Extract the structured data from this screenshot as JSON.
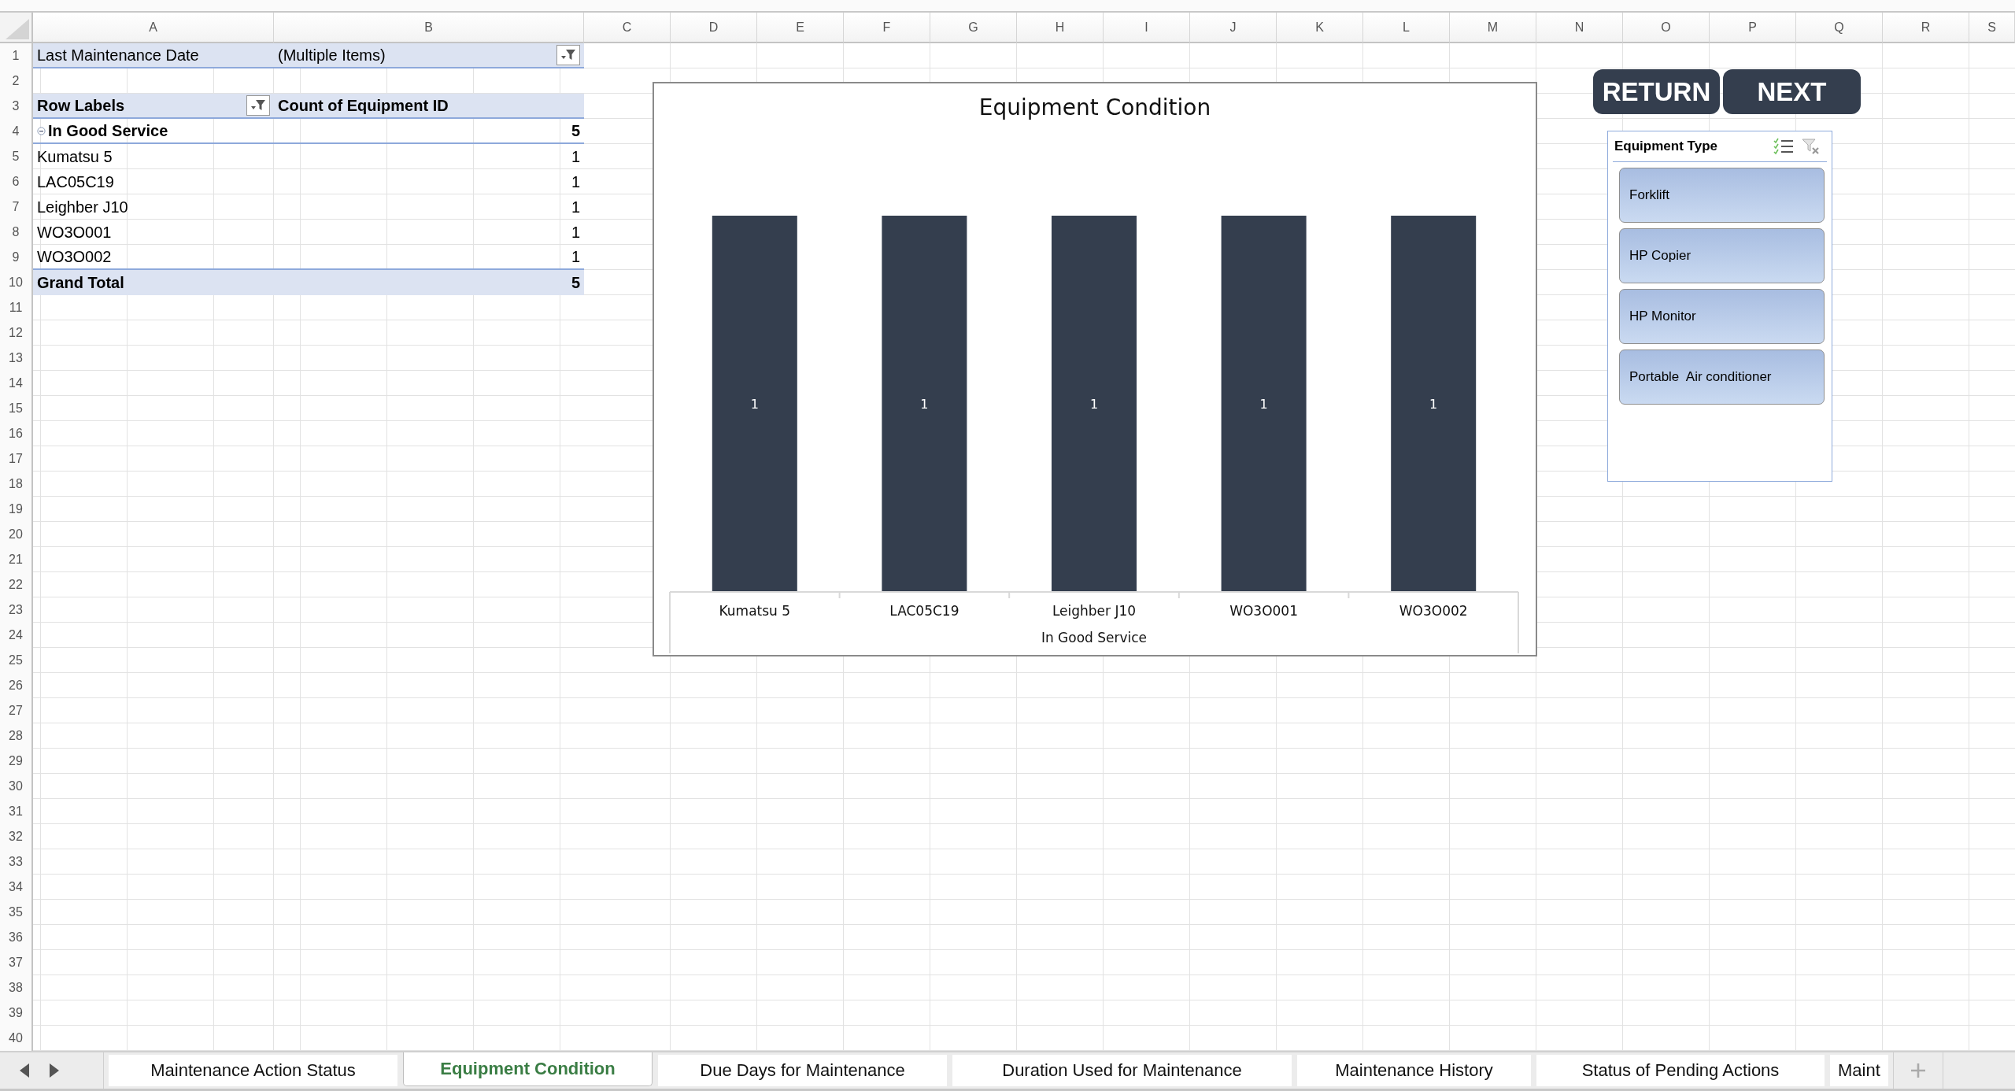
{
  "columns": [
    "A",
    "B",
    "C",
    "D",
    "E",
    "F",
    "G",
    "H",
    "I",
    "J",
    "K",
    "L",
    "M",
    "N",
    "O",
    "P",
    "Q",
    "R",
    "S"
  ],
  "rows": [
    "1",
    "2",
    "3",
    "4",
    "5",
    "6",
    "7",
    "8",
    "9",
    "10",
    "11",
    "12",
    "13",
    "14",
    "15",
    "16",
    "17",
    "18",
    "19",
    "20",
    "21",
    "22",
    "23",
    "24",
    "25",
    "26",
    "27",
    "28",
    "29",
    "30",
    "31",
    "32",
    "33",
    "34",
    "35",
    "36",
    "37",
    "38",
    "39",
    "40"
  ],
  "pivot": {
    "filter": {
      "label": "Last Maintenance Date",
      "value": "(Multiple Items)"
    },
    "header": {
      "row_labels": "Row Labels",
      "value_label": "Count of Equipment ID"
    },
    "group": {
      "label": "In Good Service",
      "total": "5",
      "expanded": true,
      "children": [
        {
          "label": "Kumatsu 5",
          "value": "1"
        },
        {
          "label": "LAC05C19",
          "value": "1"
        },
        {
          "label": "Leighber J10",
          "value": "1"
        },
        {
          "label": "WO3O001",
          "value": "1"
        },
        {
          "label": "WO3O002",
          "value": "1"
        }
      ]
    },
    "grand_total": {
      "label": "Grand Total",
      "value": "5"
    }
  },
  "chart": {
    "chart_data": {
      "type": "bar",
      "title": "Equipment Condition",
      "xlabel": "In Good Service",
      "categories": [
        "Kumatsu 5",
        "LAC05C19",
        "Leighber J10",
        "WO3O001",
        "WO3O002"
      ],
      "values": [
        1,
        1,
        1,
        1,
        1
      ],
      "data_labels": true
    }
  },
  "buttons": [
    {
      "label": "RETURN"
    },
    {
      "label": "NEXT"
    }
  ],
  "slicer": {
    "title": "Equipment Type",
    "items": [
      {
        "label": "Forklift",
        "selected": true
      },
      {
        "label": "HP Copier",
        "selected": true
      },
      {
        "label": "HP Monitor",
        "selected": true
      },
      {
        "label": "Portable  Air conditioner",
        "selected": true
      }
    ]
  },
  "sheet_tabs": [
    {
      "label": "Maintenance Action Status",
      "selected": false
    },
    {
      "label": "Equipment Condition",
      "selected": true
    },
    {
      "label": "Due Days for Maintenance",
      "selected": false
    },
    {
      "label": "Duration Used for Maintenance",
      "selected": false
    },
    {
      "label": "Maintenance History",
      "selected": false
    },
    {
      "label": "Status of Pending Actions",
      "selected": false
    },
    {
      "label": "Maint",
      "selected": false
    }
  ]
}
